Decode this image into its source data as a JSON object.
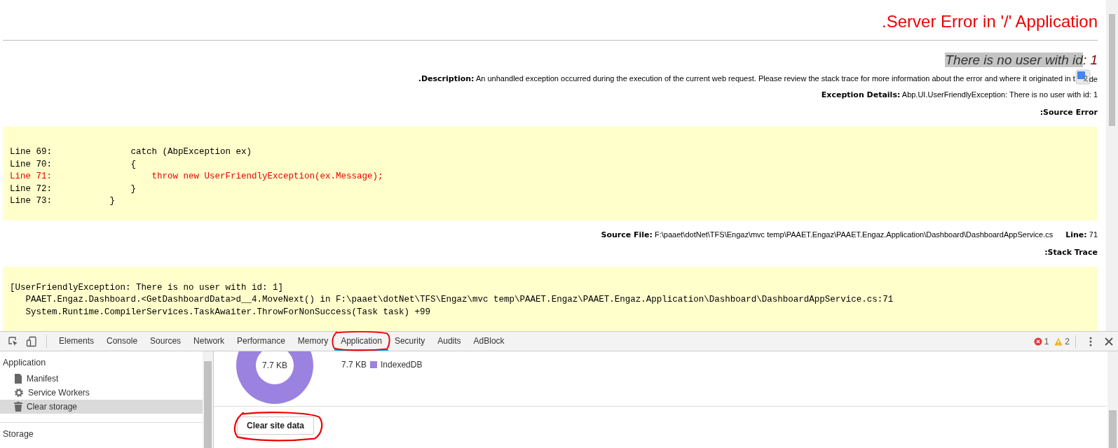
{
  "page": {
    "title": ".Server Error in '/' Application",
    "message": {
      "highlighted": "There is no user with id",
      "rest": ": 1"
    },
    "description": {
      "label": ".Description:",
      "text": "An unhandled exception occurred during the execution of the current web request. Please review the stack trace for more information about the error and where it originated in t",
      "tail": "de"
    },
    "exception_details": {
      "label": "Exception Details:",
      "text": "Abp.UI.UserFriendlyException: There is no user with id: 1"
    },
    "source_error_heading": ":Source Error",
    "source_lines": [
      {
        "number": "Line 69:",
        "code": "               catch (AbpException ex)",
        "error": false
      },
      {
        "number": "Line 70:",
        "code": "               {",
        "error": false
      },
      {
        "number": "Line 71:",
        "code": "                   throw new UserFriendlyException(ex.Message);",
        "error": true
      },
      {
        "number": "Line 72:",
        "code": "               }",
        "error": false
      },
      {
        "number": "Line 73:",
        "code": "           }",
        "error": false
      }
    ],
    "source_file": {
      "label": "Source File:",
      "path": "F:\\paaet\\dotNet\\TFS\\Engaz\\mvc temp\\PAAET.Engaz\\PAAET.Engaz.Application\\Dashboard\\DashboardAppService.cs",
      "line_label": "Line:",
      "line": "71"
    },
    "stack_trace_heading": ":Stack Trace",
    "stack_lines": [
      "[UserFriendlyException: There is no user with id: 1]",
      "   PAAET.Engaz.Dashboard.<GetDashboardData>d__4.MoveNext() in F:\\paaet\\dotNet\\TFS\\Engaz\\mvc temp\\PAAET.Engaz\\PAAET.Engaz.Application\\Dashboard\\DashboardAppService.cs:71",
      "   System.Runtime.CompilerServices.TaskAwaiter.ThrowForNonSuccess(Task task) +99"
    ]
  },
  "devtools": {
    "tabs": [
      {
        "label": "Elements",
        "selected": false,
        "circled": false
      },
      {
        "label": "Console",
        "selected": false,
        "circled": false
      },
      {
        "label": "Sources",
        "selected": false,
        "circled": false
      },
      {
        "label": "Network",
        "selected": false,
        "circled": false
      },
      {
        "label": "Performance",
        "selected": false,
        "circled": false
      },
      {
        "label": "Memory",
        "selected": false,
        "circled": false
      },
      {
        "label": "Application",
        "selected": true,
        "circled": true
      },
      {
        "label": "Security",
        "selected": false,
        "circled": false
      },
      {
        "label": "Audits",
        "selected": false,
        "circled": false
      },
      {
        "label": "AdBlock",
        "selected": false,
        "circled": false
      }
    ],
    "errors": "1",
    "warnings": "2",
    "sidebar": {
      "section": "Application",
      "items": [
        {
          "label": "Manifest",
          "kind": "file",
          "selected": false
        },
        {
          "label": "Service Workers",
          "kind": "gear",
          "selected": false
        },
        {
          "label": "Clear storage",
          "kind": "trash",
          "selected": true
        }
      ],
      "section2": "Storage"
    },
    "usage": {
      "total": "7.7 KB",
      "legend": [
        {
          "amount": "7.7 KB",
          "label": "IndexedDB",
          "color": "#9b82e0"
        }
      ]
    },
    "clear_button": {
      "label": "Clear site data",
      "circled": true
    }
  }
}
